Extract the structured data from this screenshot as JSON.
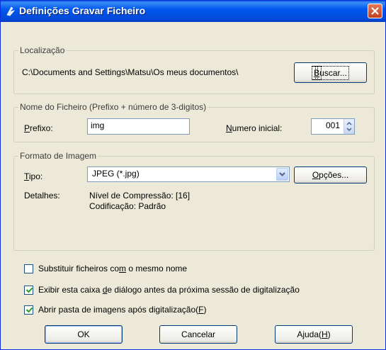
{
  "window": {
    "title": "Definições Gravar Ficheiro"
  },
  "location": {
    "group_label": "Localização",
    "path": "C:\\Documents and Settings\\Matsu\\Os meus documentos\\",
    "browse_pre": "",
    "browse_key": "B",
    "browse_post": "uscar..."
  },
  "filename": {
    "group_label": "Nome do Ficheiro (Prefixo + número de 3-digitos)",
    "prefix_key": "P",
    "prefix_post": "refixo:",
    "prefix_value": "img",
    "start_key": "N",
    "start_post": "umero inicial:",
    "start_value": "001"
  },
  "format": {
    "group_label": "Formato de Imagem",
    "type_key": "T",
    "type_post": "ipo:",
    "type_value": "JPEG (*.jpg)",
    "options_key": "O",
    "options_post": "pções...",
    "details_label": "Detalhes:",
    "details_line1": "Nível de Compressão: [16]",
    "details_line2": "Codificação: Padrão"
  },
  "checkboxes": {
    "overwrite_pre": "Substituir ficheiros co",
    "overwrite_key": "m",
    "overwrite_post": " o mesmo nome",
    "overwrite_checked": false,
    "show_dialog_pre": "Exibir esta caixa ",
    "show_dialog_key": "d",
    "show_dialog_post": "e diálogo antes da próxima sessão de digitalização",
    "show_dialog_checked": true,
    "open_folder_pre": "Abrir pasta de imagens após digitalização(",
    "open_folder_key": "F",
    "open_folder_post": ")",
    "open_folder_checked": true
  },
  "buttons": {
    "ok": "OK",
    "cancel": "Cancelar",
    "help_pre": "Ajuda(",
    "help_key": "H",
    "help_post": ")"
  },
  "icons": {
    "title": "scanner-app-icon",
    "close": "close-icon",
    "spin": "spin-updown-icon",
    "dropdown": "chevron-down-icon",
    "check": "checkmark-icon"
  },
  "colors": {
    "titlebar": "#0058ee",
    "dialog_bg": "#ece9d8",
    "close_button": "#c1401e"
  }
}
